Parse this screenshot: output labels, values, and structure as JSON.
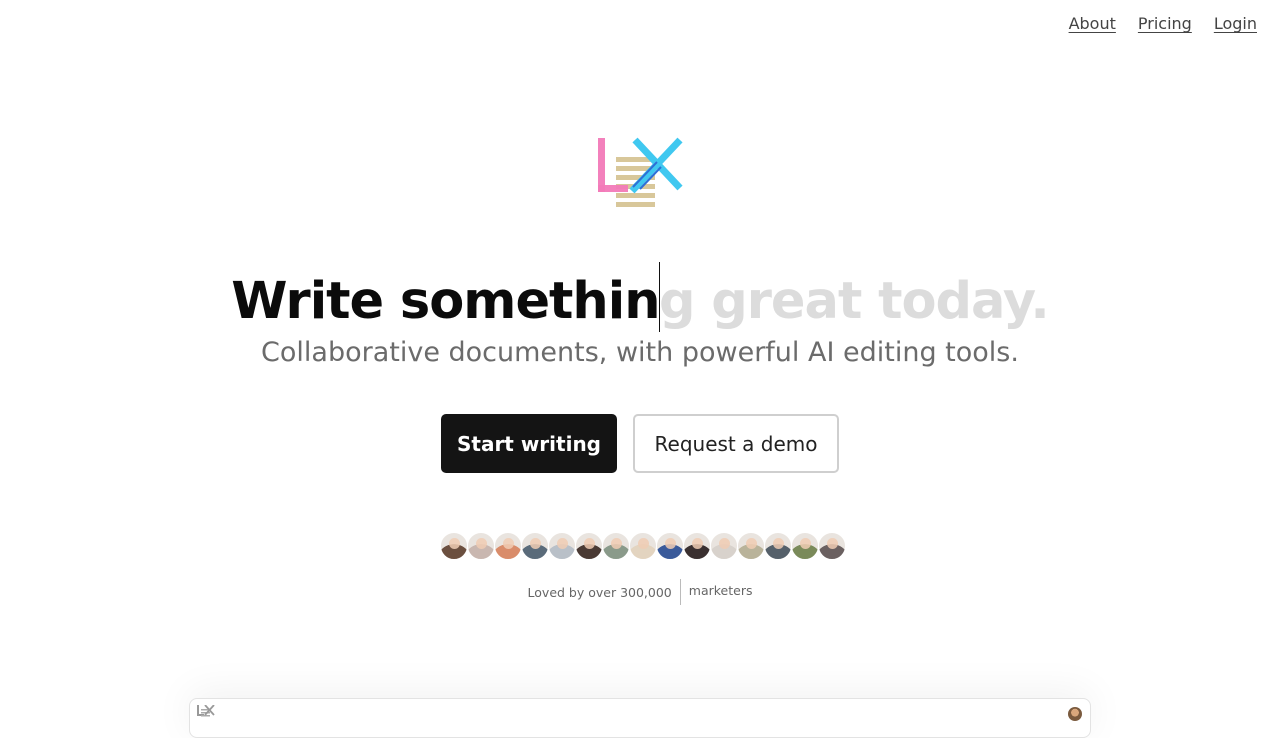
{
  "nav": {
    "about": "About",
    "pricing": "Pricing",
    "login": "Login"
  },
  "hero": {
    "headline_typed": "Write somethin",
    "headline_ghost": "g great today.",
    "subtitle": "Collaborative documents, with powerful AI editing tools.",
    "primary_cta": "Start writing",
    "secondary_cta": "Request a demo"
  },
  "social_proof": {
    "loved_text": "Loved by over 300,000",
    "audience": "marketers",
    "avatar_colors": [
      "#6b4f3f",
      "#c9b7b0",
      "#d98c6a",
      "#5a6b7a",
      "#b9c0c8",
      "#4a3a34",
      "#8a9a8a",
      "#e3d4c0",
      "#3a5a9a",
      "#3a3030",
      "#d8d2cc",
      "#b9b39a",
      "#55606a",
      "#7a8a5a",
      "#6a6060"
    ]
  },
  "colors": {
    "primary_button": "#141414",
    "ghost_text": "#dcdcdc",
    "subtitle": "#6b6b6b"
  },
  "icons": {
    "logo": "lex-logo-icon",
    "preview_logo": "lex-mini-logo-icon",
    "preview_avatar": "user-avatar"
  }
}
